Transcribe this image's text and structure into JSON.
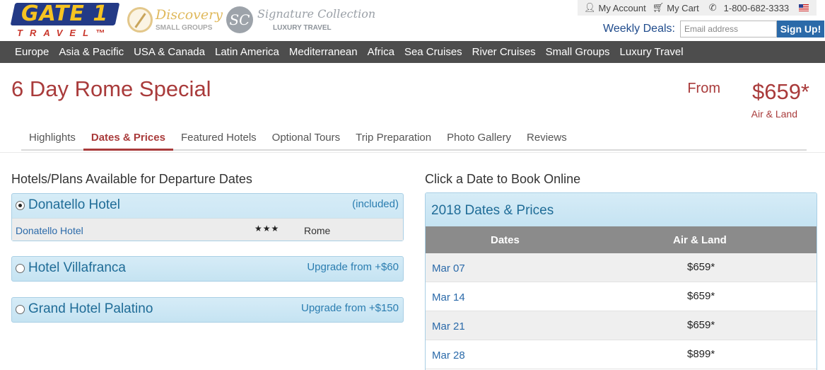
{
  "brand": {
    "gate1_word": "GATE 1",
    "gate1_sub": "TRAVEL™",
    "discovery_title": "Discovery",
    "discovery_sub": "SMALL GROUPS",
    "signature_badge": "SC",
    "signature_title": "Signature Collection",
    "signature_sub": "LUXURY TRAVEL"
  },
  "utility": {
    "account": "My Account",
    "cart": "My Cart",
    "phone": "1-800-682-3333"
  },
  "deals": {
    "label": "Weekly Deals:",
    "placeholder": "Email address",
    "button": "Sign Up!"
  },
  "nav": [
    "Europe",
    "Asia & Pacific",
    "USA & Canada",
    "Latin America",
    "Mediterranean",
    "Africa",
    "Sea Cruises",
    "River Cruises",
    "Small Groups",
    "Luxury Travel"
  ],
  "tour": {
    "title": "6 Day Rome Special",
    "price_from": "From",
    "price": "$659*",
    "price_sub": "Air & Land"
  },
  "tabs": [
    "Highlights",
    "Dates & Prices",
    "Featured Hotels",
    "Optional Tours",
    "Trip Preparation",
    "Photo Gallery",
    "Reviews"
  ],
  "active_tab": "Dates & Prices",
  "left": {
    "title": "Hotels/Plans Available for Departure Dates",
    "plans": [
      {
        "name": "Donatello Hotel",
        "note": "(included)",
        "selected": true,
        "detail": {
          "hotel": "Donatello Hotel",
          "stars": "★★★",
          "city": "Rome"
        }
      },
      {
        "name": "Hotel Villafranca",
        "note": "Upgrade from +$60",
        "selected": false
      },
      {
        "name": "Grand Hotel Palatino",
        "note": "Upgrade from +$150",
        "selected": false
      }
    ]
  },
  "right": {
    "title": "Click a Date to Book Online",
    "panel_title": "2018 Dates & Prices",
    "col_dates": "Dates",
    "col_price": "Air & Land",
    "rows": [
      {
        "date": "Mar 07",
        "price": "$659*"
      },
      {
        "date": "Mar 14",
        "price": "$659*"
      },
      {
        "date": "Mar 21",
        "price": "$659*"
      },
      {
        "date": "Mar 28",
        "price": "$899*"
      }
    ]
  },
  "colors": {
    "brand_red": "#a93b3b",
    "nav_bg": "#4d4d4d",
    "link_blue": "#2b6aa9",
    "panel_blue": "#c5e3f2"
  }
}
